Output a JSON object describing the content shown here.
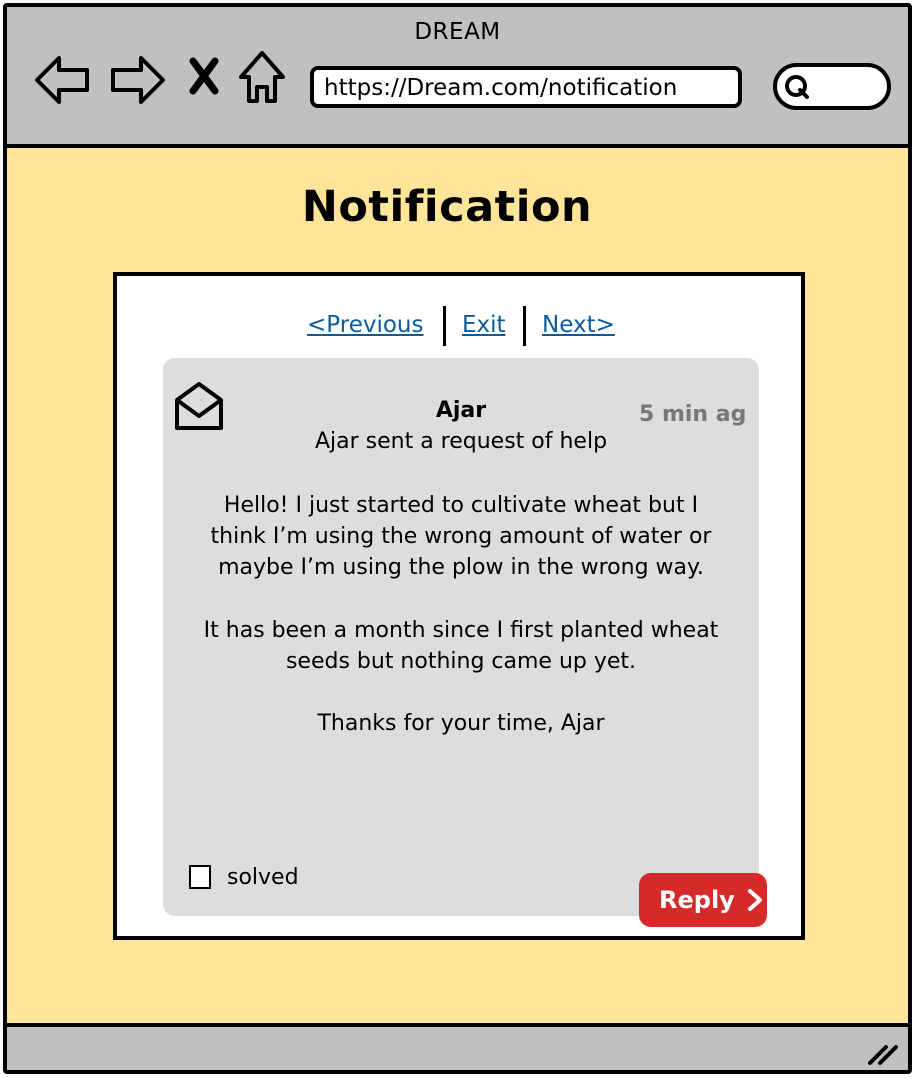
{
  "window": {
    "title": "DREAM"
  },
  "toolbar": {
    "back_icon": "back-arrow-icon",
    "forward_icon": "forward-arrow-icon",
    "close_icon": "close-icon",
    "home_icon": "home-icon",
    "url": "https://Dream.com/notification",
    "search_icon": "search-icon",
    "search_placeholder": ""
  },
  "page": {
    "title": "Notification"
  },
  "pager": {
    "previous": "<Previous",
    "exit": "Exit",
    "next": "Next>"
  },
  "message": {
    "icon": "envelope-open-icon",
    "sender": "Ajar",
    "time": "5 min ag",
    "summary": "Ajar sent a request of help",
    "paragraphs": [
      "Hello! I just started to cultivate wheat but I think I’m using the wrong amount of water or maybe I’m using the plow in the wrong way.",
      "It has been a month since I first planted wheat seeds but nothing came up yet.",
      "Thanks for your time, Ajar"
    ],
    "solved_label": "solved",
    "solved_checked": false,
    "reply_label": "Reply"
  },
  "colors": {
    "page_background": "#ffe599",
    "toolbar_background": "#c0c0c0",
    "message_background": "#dddddd",
    "link": "#0b5a9c",
    "reply_button": "#d62a2a",
    "time_text": "#777777"
  }
}
